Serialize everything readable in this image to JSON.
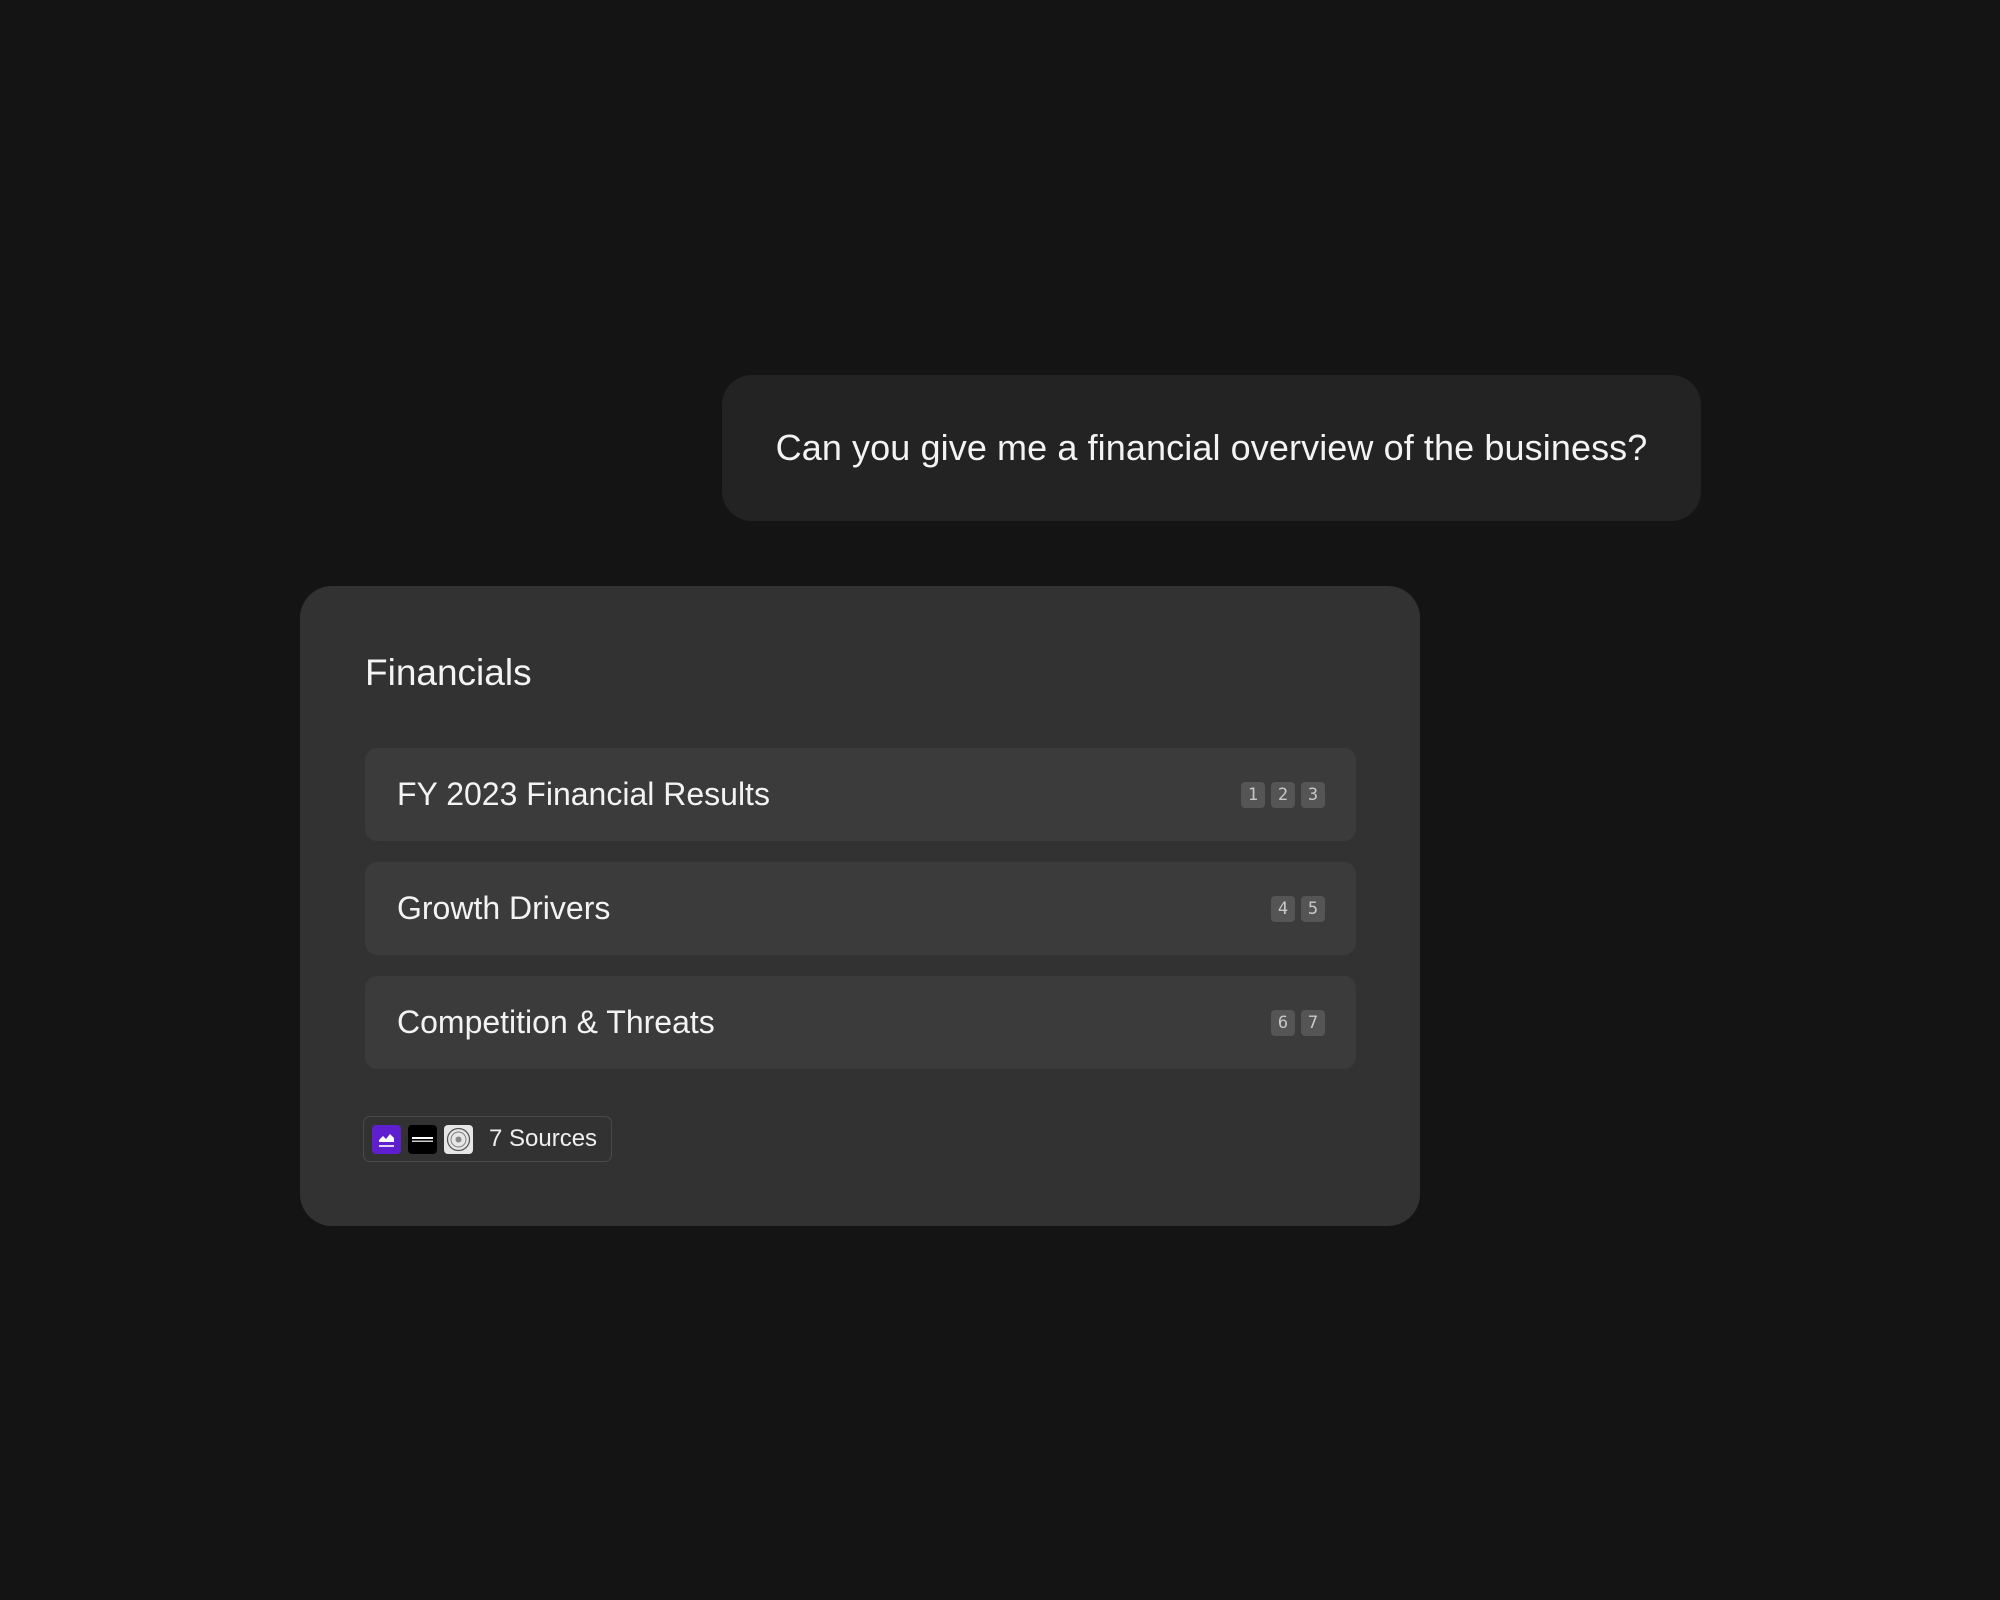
{
  "conversation": {
    "user_message": "Can you give me a financial overview of the business?",
    "response": {
      "title": "Financials",
      "topics": [
        {
          "label": "FY 2023 Financial Results",
          "citations": [
            "1",
            "2",
            "3"
          ]
        },
        {
          "label": "Growth Drivers",
          "citations": [
            "4",
            "5"
          ]
        },
        {
          "label": "Competition & Threats",
          "citations": [
            "6",
            "7"
          ]
        }
      ],
      "sources": {
        "label": "7 Sources",
        "logos": [
          "yahoo-finance-logo",
          "bloomberg-logo",
          "sec-seal-logo"
        ]
      }
    }
  },
  "colors": {
    "background": "#141414",
    "user_bubble": "#232323",
    "card": "#323232",
    "topic_row": "#3b3b3b",
    "citation_badge": "#555555",
    "yahoo_purple": "#5f1fce"
  }
}
